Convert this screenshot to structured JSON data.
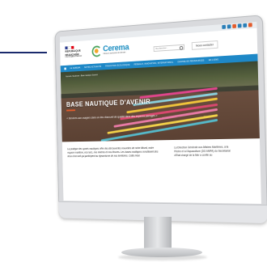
{
  "utility_bar": {
    "icons": [
      "social-icon",
      "social-icon",
      "social-icon",
      "social-icon",
      "social-icon",
      "social-icon"
    ]
  },
  "header": {
    "gov_block": {
      "line1": "RÉPUBLIQUE",
      "line2": "FRANÇAISE",
      "motto": "Liberté Égalité Fraternité"
    },
    "logo": {
      "name": "Cerema",
      "tagline": "Climat & territoires de demain"
    },
    "search_placeholder": "Rechercher...",
    "contact_label": "Nous contacter"
  },
  "nav": {
    "items": [
      "LE CEREMA",
      "NOTRE ACTUALITÉ",
      "TRANSITION ÉCOLOGIQUE",
      "RÉSEAUX, INNOVATION, INTERNATIONAL",
      "CENTRE DE RESSOURCES",
      "EN LIGNE"
    ]
  },
  "hero": {
    "breadcrumb": "Accueil › Nautisme › Base nautique d'avenir",
    "title": "BASE NAUTIQUE D'AVENIR",
    "subtitle": "« Services aux usagers dans un lieu d'accueil de qualité dans des espaces partagés »"
  },
  "content": {
    "left_paragraph": "La pratique des sports nautiques offre des découvertes nouvelles de notre littoral, notre espace maritime, nos lacs, nos rivières et nos fleuves. Les bases nautiques constituent des lieux d'accueil qui participent au dynamisme de nos territoires. Cette mise",
    "right_paragraph": "La Direction Générale aux Affaires Maritimes, à la Pêche et à l'Aquaculture (DG AMPA) du Secrétariat d'Etat chargé de la Mer a confié au"
  },
  "colors": {
    "nav_bg": "#1e88c7",
    "accent": "#e35b2b",
    "logo_blue": "#1f8fc2",
    "logo_green": "#4aa35c",
    "logo_orange": "#f2a72b"
  }
}
